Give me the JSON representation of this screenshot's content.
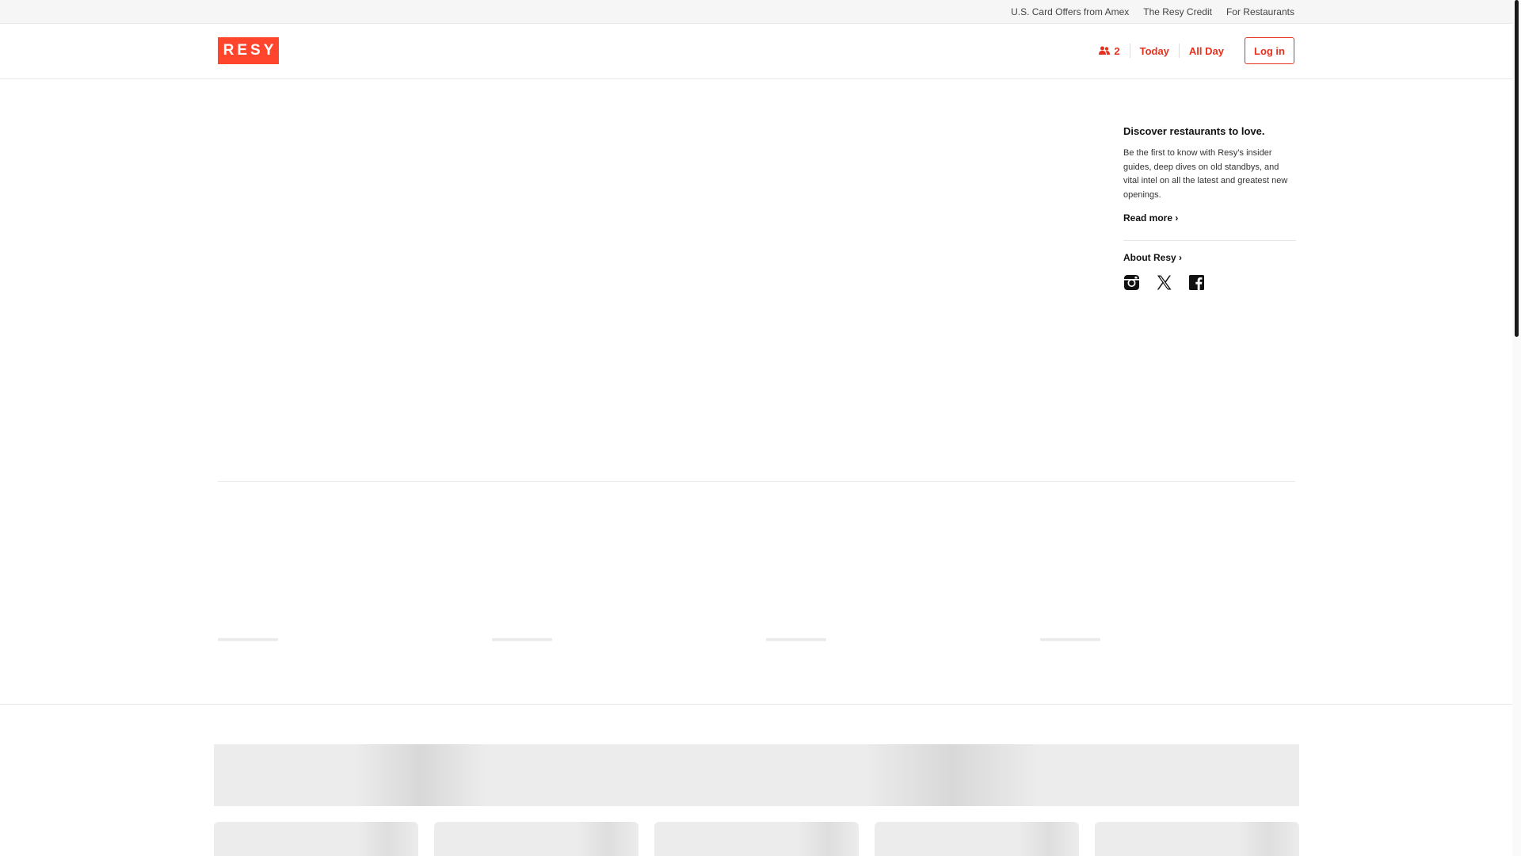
{
  "utility_bar": {
    "links": [
      "U.S. Card Offers from Amex",
      "The Resy Credit",
      "For Restaurants"
    ]
  },
  "header": {
    "logo_text": "RESY",
    "brand_color": "#ff462d",
    "guest_icon": "guests-icon",
    "guests": "2",
    "date": "Today",
    "time": "All Day",
    "login": "Log in"
  },
  "promo": {
    "title": "Discover restaurants to love.",
    "body": "Be the first to know with Resy’s insider guides, deep dives on old standbys, and vital intel on all the latest and greatest new openings.",
    "read_more": "Read more ›",
    "about": "About Resy ›",
    "social_icons": [
      "instagram-icon",
      "x-icon",
      "facebook-icon"
    ]
  }
}
